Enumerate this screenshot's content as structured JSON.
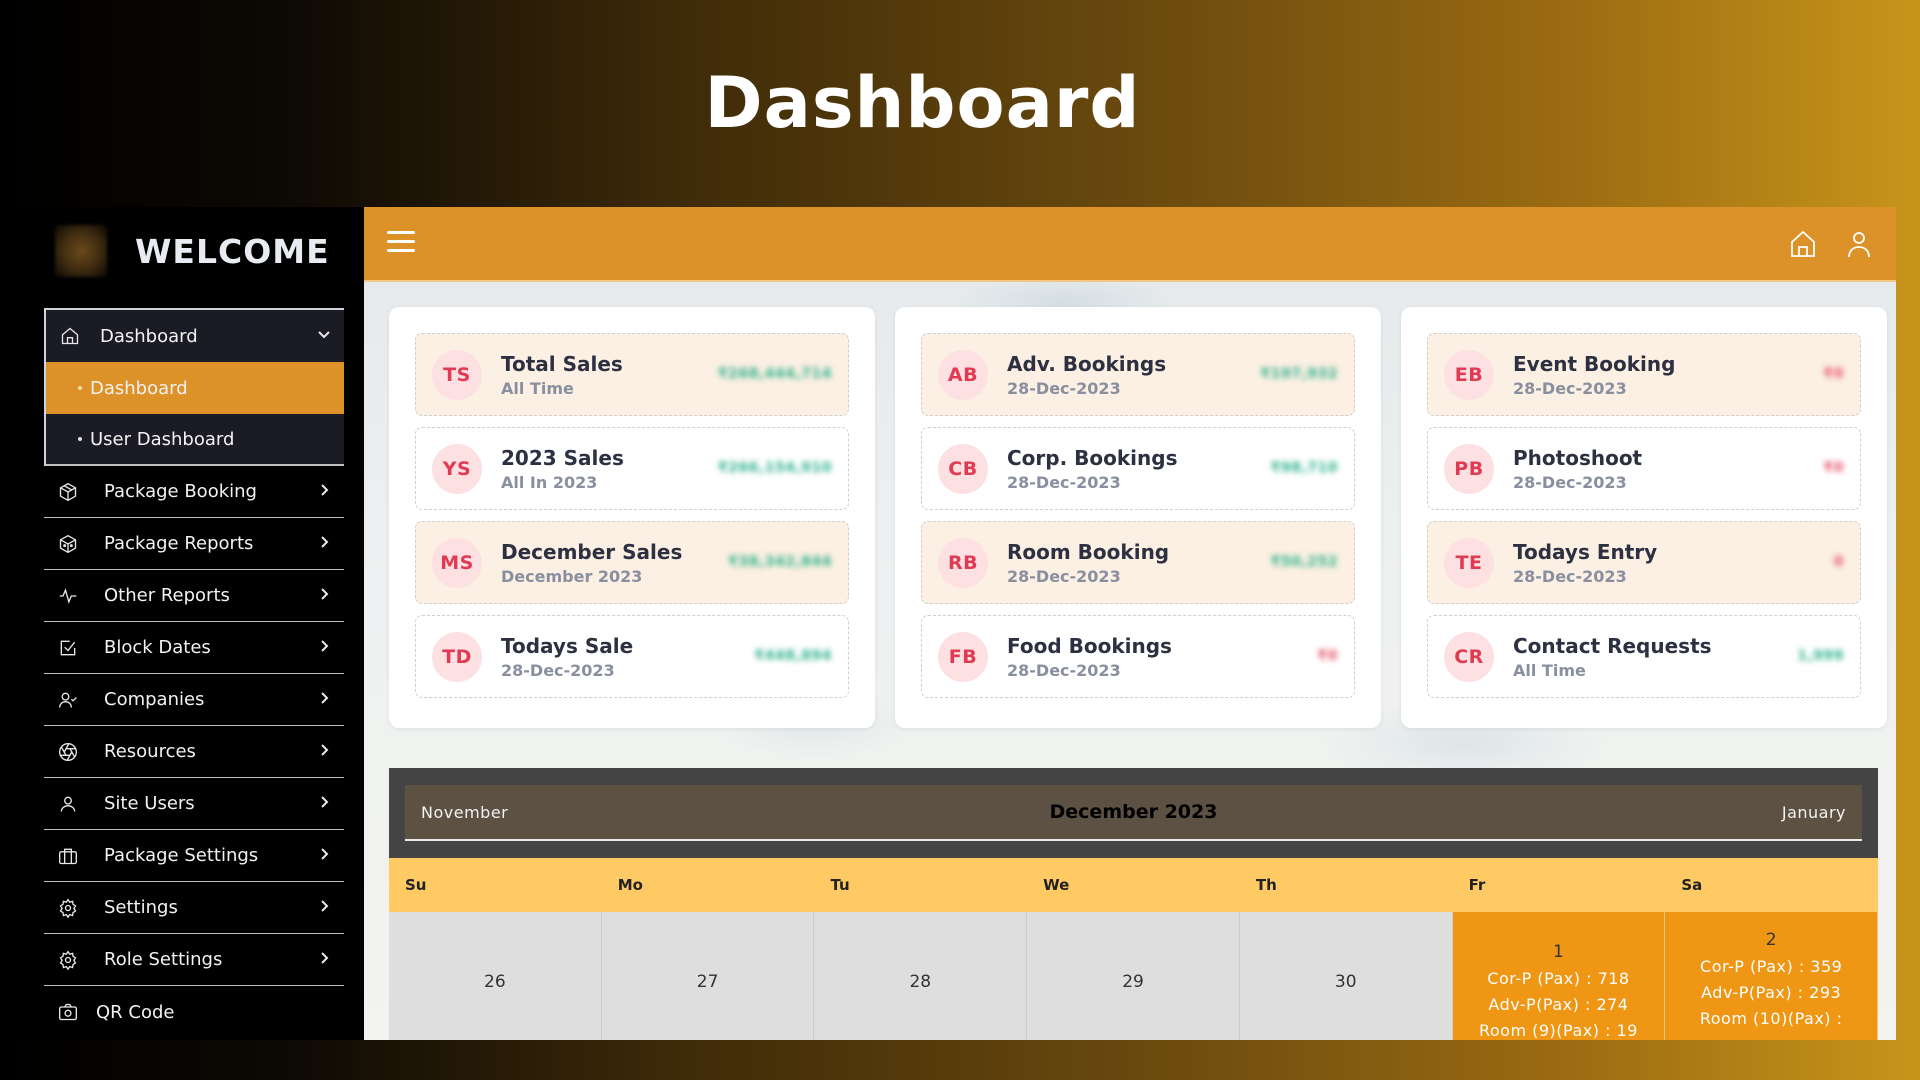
{
  "page": {
    "title": "Dashboard"
  },
  "sidebar": {
    "brand": "WELCOME",
    "group": {
      "label": "Dashboard",
      "children": [
        {
          "label": "Dashboard",
          "active": true
        },
        {
          "label": "User Dashboard",
          "active": false
        }
      ]
    },
    "items": [
      {
        "label": "Package Booking",
        "icon": "package-booking-icon"
      },
      {
        "label": "Package Reports",
        "icon": "package-reports-icon"
      },
      {
        "label": "Other Reports",
        "icon": "activity-icon"
      },
      {
        "label": "Block Dates",
        "icon": "checkbox-icon"
      },
      {
        "label": "Companies",
        "icon": "user-check-icon"
      },
      {
        "label": "Resources",
        "icon": "aperture-icon"
      },
      {
        "label": "Site Users",
        "icon": "user-icon"
      },
      {
        "label": "Package Settings",
        "icon": "briefcase-icon"
      },
      {
        "label": "Settings",
        "icon": "gear-icon"
      },
      {
        "label": "Role Settings",
        "icon": "gear-icon"
      }
    ],
    "qr": {
      "label": "QR Code",
      "icon": "camera-icon"
    }
  },
  "topbar": {
    "menu_icon": "hamburger-icon",
    "home_icon": "home-icon",
    "user_icon": "user-icon"
  },
  "stats": [
    [
      {
        "abbr": "TS",
        "title": "Total Sales",
        "subtitle": "All Time",
        "value": "₹268,444,714",
        "tone": "green",
        "tint": true
      },
      {
        "abbr": "YS",
        "title": "2023 Sales",
        "subtitle": "All In 2023",
        "value": "₹266,154,910",
        "tone": "green",
        "tint": false
      },
      {
        "abbr": "MS",
        "title": "December Sales",
        "subtitle": "December 2023",
        "value": "₹38,342,844",
        "tone": "green",
        "tint": true
      },
      {
        "abbr": "TD",
        "title": "Todays Sale",
        "subtitle": "28-Dec-2023",
        "value": "₹448,894",
        "tone": "green",
        "tint": false
      }
    ],
    [
      {
        "abbr": "AB",
        "title": "Adv. Bookings",
        "subtitle": "28-Dec-2023",
        "value": "₹197,932",
        "tone": "green",
        "tint": true
      },
      {
        "abbr": "CB",
        "title": "Corp. Bookings",
        "subtitle": "28-Dec-2023",
        "value": "₹98,710",
        "tone": "green",
        "tint": false
      },
      {
        "abbr": "RB",
        "title": "Room Booking",
        "subtitle": "28-Dec-2023",
        "value": "₹50,252",
        "tone": "green",
        "tint": true
      },
      {
        "abbr": "FB",
        "title": "Food Bookings",
        "subtitle": "28-Dec-2023",
        "value": "₹0",
        "tone": "red",
        "tint": false
      }
    ],
    [
      {
        "abbr": "EB",
        "title": "Event Booking",
        "subtitle": "28-Dec-2023",
        "value": "₹0",
        "tone": "red",
        "tint": true
      },
      {
        "abbr": "PB",
        "title": "Photoshoot",
        "subtitle": "28-Dec-2023",
        "value": "₹0",
        "tone": "red",
        "tint": false
      },
      {
        "abbr": "TE",
        "title": "Todays Entry",
        "subtitle": "28-Dec-2023",
        "value": "0",
        "tone": "red",
        "tint": true
      },
      {
        "abbr": "CR",
        "title": "Contact Requests",
        "subtitle": "All Time",
        "value": "1,999",
        "tone": "green",
        "tint": false
      }
    ]
  ],
  "calendar": {
    "prev": "November",
    "month": "December 2023",
    "next": "January",
    "weekdays": [
      "Su",
      "Mo",
      "Tu",
      "We",
      "Th",
      "Fr",
      "Sa"
    ],
    "week": [
      {
        "day": "26",
        "lines": []
      },
      {
        "day": "27",
        "lines": []
      },
      {
        "day": "28",
        "lines": []
      },
      {
        "day": "29",
        "lines": []
      },
      {
        "day": "30",
        "lines": []
      },
      {
        "day": "1",
        "lines": [
          "Cor-P (Pax) : 718",
          "Adv-P(Pax) : 274",
          "Room  (9)(Pax) : 19"
        ]
      },
      {
        "day": "2",
        "lines": [
          "Cor-P (Pax) : 359",
          "Adv-P(Pax) : 293",
          "Room  (10)(Pax) :"
        ]
      }
    ]
  },
  "colors": {
    "accent": "#dc9228",
    "calendar_header": "#5c5143",
    "weekday_bar": "#ffca64",
    "active_day": "#ef9614",
    "avatar_bg": "#fde0e2",
    "avatar_text": "#e03b52",
    "value_green": "#2bb08a",
    "value_red": "#e8506a"
  }
}
